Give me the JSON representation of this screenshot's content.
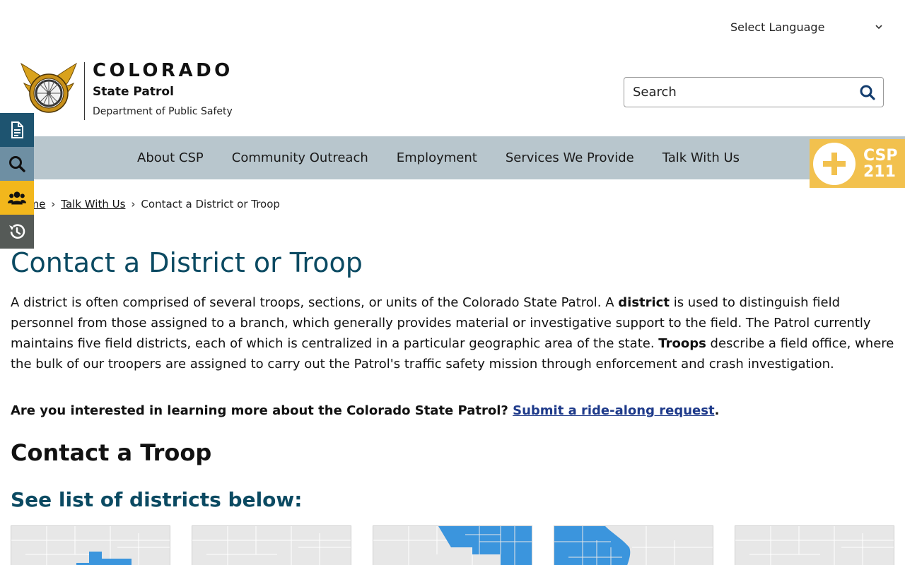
{
  "language": {
    "label": "Select Language"
  },
  "logo": {
    "title": "COLORADO",
    "subtitle": "State Patrol",
    "department": "Department of Public Safety",
    "badge_top": "STATE PATROL",
    "badge_bottom": "COLORADO"
  },
  "search": {
    "placeholder": "Search"
  },
  "nav": {
    "items": [
      {
        "label": "About CSP"
      },
      {
        "label": "Community Outreach"
      },
      {
        "label": "Employment"
      },
      {
        "label": "Services We Provide"
      },
      {
        "label": "Talk With Us"
      }
    ]
  },
  "csp211": {
    "line1": "CSP",
    "line2": "211"
  },
  "sidebar": {
    "icons": [
      "document-icon",
      "search-icon",
      "people-icon",
      "history-icon"
    ]
  },
  "breadcrumb": {
    "home": "Home",
    "parent": "Talk With Us",
    "current": "Contact a District or Troop"
  },
  "content": {
    "title": "Contact a District or Troop",
    "intro_p1": "A district is often comprised of several troops, sections, or units of the Colorado State Patrol. A ",
    "intro_b1": "district",
    "intro_p2": " is used to distinguish field personnel from those assigned to a branch, which generally provides material or investigative support to the field. The Patrol currently maintains five field districts, each of which is centralized in a particular geographic area of the state. ",
    "intro_b2": "Troops",
    "intro_p3": " describe a field office, where the bulk of our troopers are assigned to carry out the Patrol's traffic safety mission through enforcement and crash investigation.",
    "ride_question": "Are you interested in learning more about the Colorado State Patrol? ",
    "ride_link": "Submit a ride-along request",
    "ride_end": ".",
    "contact_heading": "Contact a Troop",
    "districts_heading": "See list of districts below:"
  },
  "colors": {
    "title_blue": "#0b4a62",
    "nav_bg": "#b8c6cd",
    "map_highlight": "#3b95dd",
    "csp211_yellow": "#f2c14e",
    "sidebar_dark_blue": "#1e5470",
    "sidebar_blue": "#6e8fa3",
    "sidebar_yellow": "#f2b71c",
    "sidebar_gray": "#555a57"
  }
}
